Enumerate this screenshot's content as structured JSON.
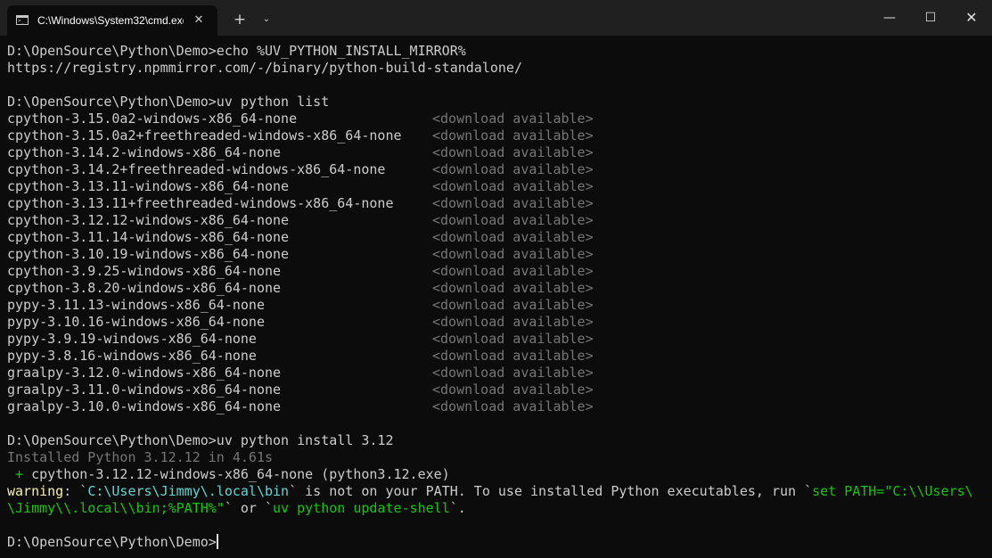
{
  "window": {
    "tab_title": "C:\\Windows\\System32\\cmd.exe",
    "tab_icon": "cmd-prompt-icon",
    "tab_close": "✕",
    "new_tab": "+",
    "dropdown": "⌄",
    "minimize": "—",
    "maximize": "☐",
    "close": "✕"
  },
  "terminal": {
    "echo_command": "D:\\OpenSource\\Python\\Demo>echo %UV_PYTHON_INSTALL_MIRROR%",
    "echo_output": "https://registry.npmmirror.com/-/binary/python-build-standalone/",
    "list_command": "D:\\OpenSource\\Python\\Demo>uv python list",
    "python_list": [
      {
        "name": "cpython-3.15.0a2-windows-x86_64-none",
        "status": "<download available>"
      },
      {
        "name": "cpython-3.15.0a2+freethreaded-windows-x86_64-none",
        "status": "<download available>"
      },
      {
        "name": "cpython-3.14.2-windows-x86_64-none",
        "status": "<download available>"
      },
      {
        "name": "cpython-3.14.2+freethreaded-windows-x86_64-none",
        "status": "<download available>"
      },
      {
        "name": "cpython-3.13.11-windows-x86_64-none",
        "status": "<download available>"
      },
      {
        "name": "cpython-3.13.11+freethreaded-windows-x86_64-none",
        "status": "<download available>"
      },
      {
        "name": "cpython-3.12.12-windows-x86_64-none",
        "status": "<download available>"
      },
      {
        "name": "cpython-3.11.14-windows-x86_64-none",
        "status": "<download available>"
      },
      {
        "name": "cpython-3.10.19-windows-x86_64-none",
        "status": "<download available>"
      },
      {
        "name": "cpython-3.9.25-windows-x86_64-none",
        "status": "<download available>"
      },
      {
        "name": "cpython-3.8.20-windows-x86_64-none",
        "status": "<download available>"
      },
      {
        "name": "pypy-3.11.13-windows-x86_64-none",
        "status": "<download available>"
      },
      {
        "name": "pypy-3.10.16-windows-x86_64-none",
        "status": "<download available>"
      },
      {
        "name": "pypy-3.9.19-windows-x86_64-none",
        "status": "<download available>"
      },
      {
        "name": "pypy-3.8.16-windows-x86_64-none",
        "status": "<download available>"
      },
      {
        "name": "graalpy-3.12.0-windows-x86_64-none",
        "status": "<download available>"
      },
      {
        "name": "graalpy-3.11.0-windows-x86_64-none",
        "status": "<download available>"
      },
      {
        "name": "graalpy-3.10.0-windows-x86_64-none",
        "status": "<download available>"
      }
    ],
    "install_command": "D:\\OpenSource\\Python\\Demo>uv python install 3.12",
    "installed_line": "Installed Python 3.12.12 in 4.61s",
    "installed_item": {
      "prefix": " + ",
      "name": "cpython-3.12.12-windows-x86_64-none",
      "exe": " (python3.12.exe)"
    },
    "warning": {
      "label": "warning",
      "p1": ": `",
      "path": "C:\\Users\\Jimmy\\.local\\bin",
      "p2": "` is not on your PATH. To use installed Python executables, run `",
      "cmd1_a": "set PATH=\"C:\\\\Users\\",
      "cmd1_b": "\\Jimmy\\\\.local\\\\bin;%PATH%\"",
      "p3": "` or `",
      "cmd2": "uv python update-shell",
      "p4": "`."
    },
    "prompt": "D:\\OpenSource\\Python\\Demo>"
  },
  "colors": {
    "background": "#0c0c0c",
    "titlebar": "#202020",
    "text": "#cccccc",
    "dim": "#767676",
    "warning": "#f9f1a5",
    "path": "#61d6d6",
    "command": "#16c60c"
  }
}
